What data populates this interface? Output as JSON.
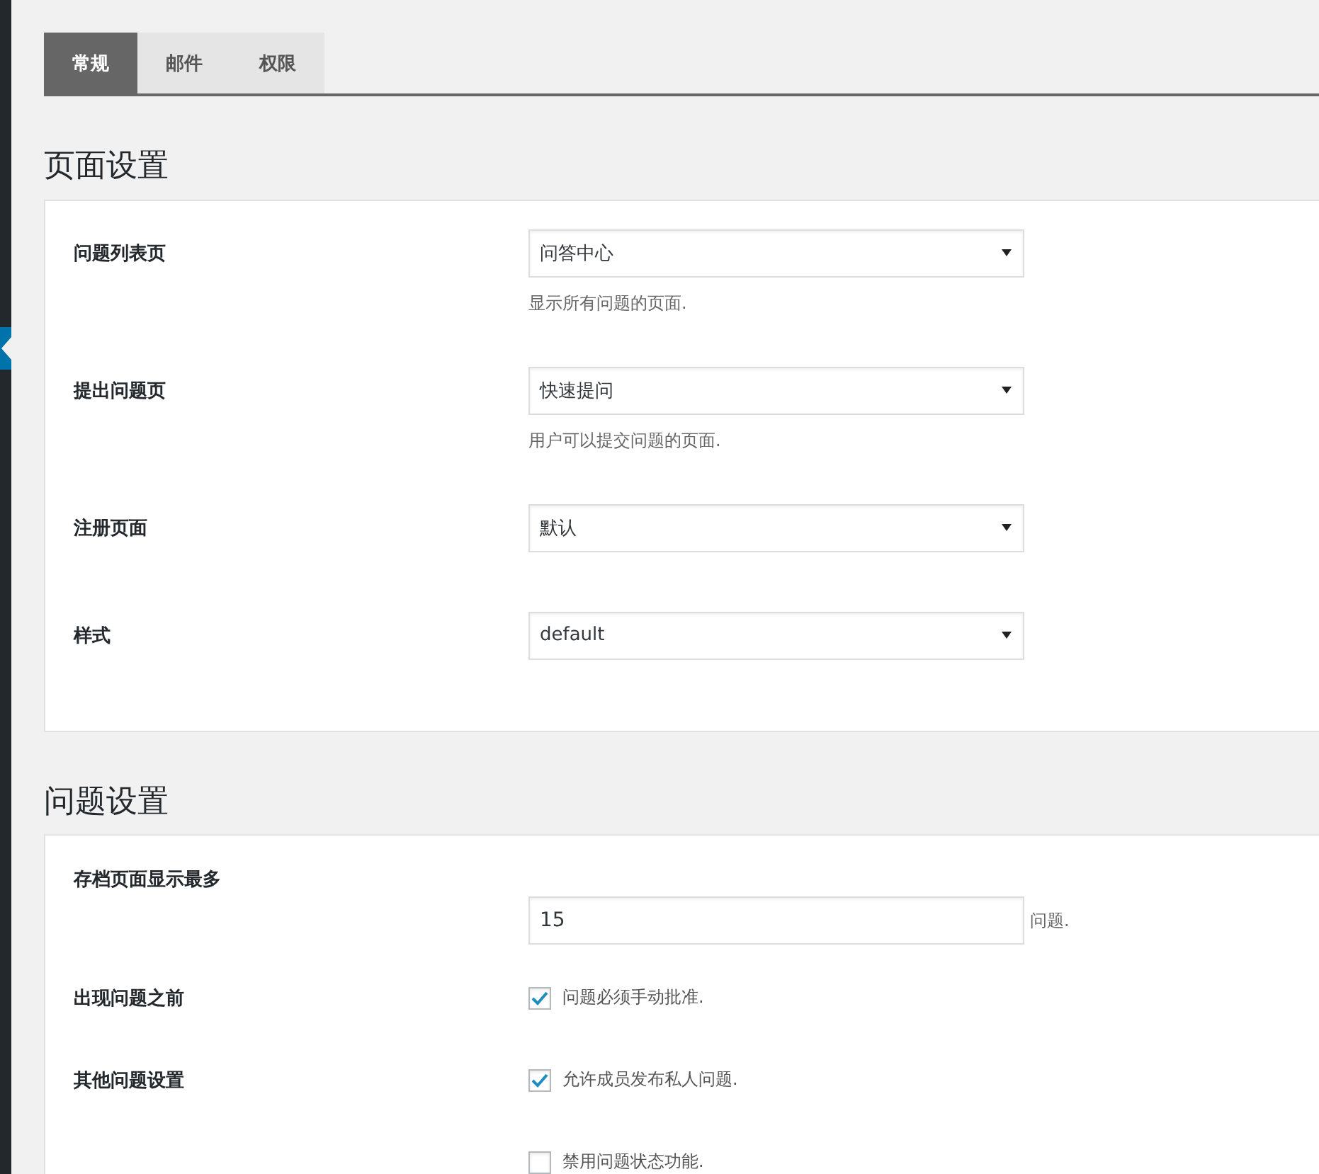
{
  "tabs": [
    {
      "label": "常规",
      "selected": true
    },
    {
      "label": "邮件",
      "selected": false
    },
    {
      "label": "权限",
      "selected": false
    }
  ],
  "sections": [
    {
      "title": "页面设置",
      "rows": [
        {
          "kind": "select",
          "label": "问题列表页",
          "value": "问答中心",
          "description": "显示所有问题的页面."
        },
        {
          "kind": "select",
          "label": "提出问题页",
          "value": "快速提问",
          "description": "用户可以提交问题的页面."
        },
        {
          "kind": "select",
          "label": "注册页面",
          "value": "默认"
        },
        {
          "kind": "select",
          "label": "样式",
          "value": "default"
        }
      ]
    },
    {
      "title": "问题设置",
      "rows": [
        {
          "kind": "number",
          "label": "存档页面显示最多",
          "value": "15",
          "suffix": "问题."
        },
        {
          "kind": "checkboxes",
          "label": "出现问题之前",
          "options": [
            {
              "label": "问题必须手动批准.",
              "checked": true
            }
          ]
        },
        {
          "kind": "checkboxes",
          "label": "其他问题设置",
          "options": [
            {
              "label": "允许成员发布私人问题.",
              "checked": true
            },
            {
              "label": "禁用问题状态功能.",
              "checked": false
            }
          ]
        }
      ]
    }
  ]
}
